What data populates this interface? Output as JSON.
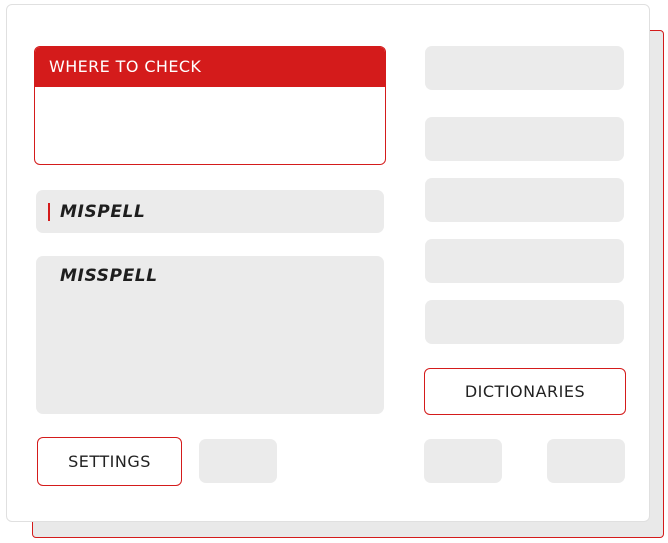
{
  "panel": {
    "group_title": "WHERE TO CHECK",
    "word_field": {
      "value": "MISPELL"
    },
    "suggestions": [
      "MISSPELL"
    ],
    "buttons": {
      "dictionaries": "DICTIONARIES",
      "settings": "SETTINGS"
    }
  },
  "colors": {
    "accent": "#d41b1b",
    "placeholder": "#ebebeb",
    "background": "#ffffff"
  }
}
